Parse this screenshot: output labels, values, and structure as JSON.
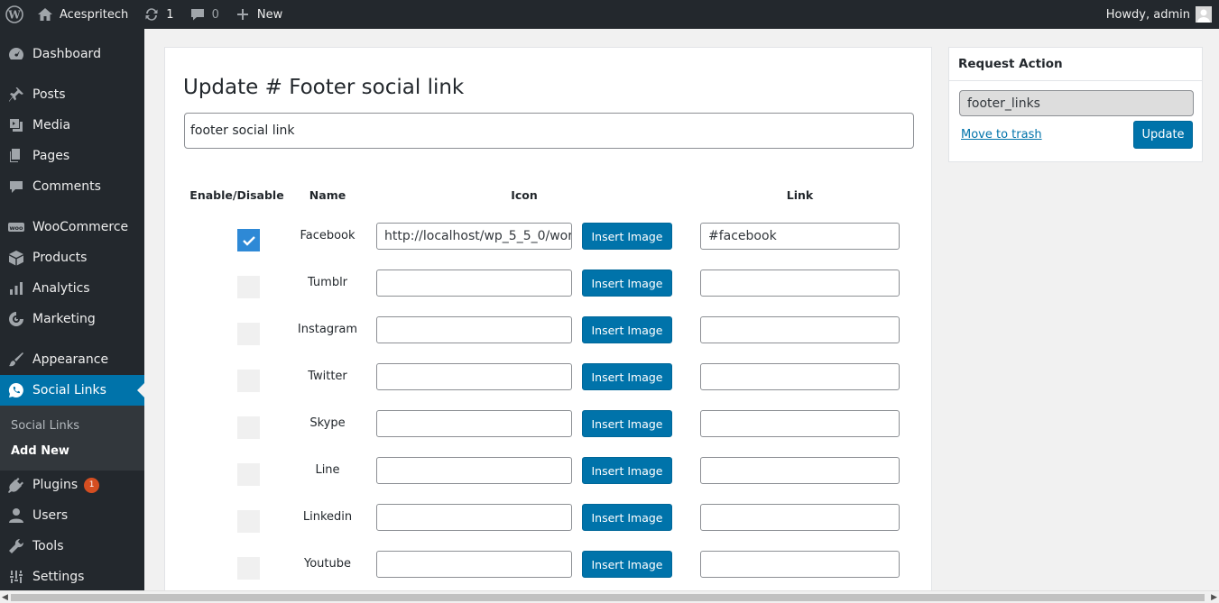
{
  "adminbar": {
    "site_name": "Acespritech",
    "updates_count": "1",
    "comments_count": "0",
    "new_label": "New",
    "greeting": "Howdy, admin"
  },
  "sidebar": {
    "items": [
      {
        "label": "Dashboard",
        "icon": "dashboard-icon"
      },
      {
        "label": "Posts",
        "icon": "pin-icon"
      },
      {
        "label": "Media",
        "icon": "media-icon"
      },
      {
        "label": "Pages",
        "icon": "pages-icon"
      },
      {
        "label": "Comments",
        "icon": "comment-icon"
      },
      {
        "label": "WooCommerce",
        "icon": "woo-icon"
      },
      {
        "label": "Products",
        "icon": "box-icon"
      },
      {
        "label": "Analytics",
        "icon": "bar-chart-icon"
      },
      {
        "label": "Marketing",
        "icon": "megaphone-icon"
      },
      {
        "label": "Appearance",
        "icon": "brush-icon"
      },
      {
        "label": "Social Links",
        "icon": "whatsapp-icon"
      },
      {
        "label": "Plugins",
        "icon": "plug-icon",
        "badge": "1"
      },
      {
        "label": "Users",
        "icon": "user-icon"
      },
      {
        "label": "Tools",
        "icon": "wrench-icon"
      },
      {
        "label": "Settings",
        "icon": "settings-icon"
      }
    ],
    "submenu": [
      "Social Links",
      "Add New"
    ]
  },
  "main": {
    "title": "Update # Footer social link",
    "title_value": "footer social link",
    "columns": {
      "enable": "Enable/Disable",
      "name": "Name",
      "icon": "Icon",
      "link": "Link"
    },
    "insert_label": "Insert Image",
    "rows": [
      {
        "name": "Facebook",
        "enabled": true,
        "icon_url": "http://localhost/wp_5_5_0/wor",
        "link": "#facebook"
      },
      {
        "name": "Tumblr",
        "enabled": false,
        "icon_url": "",
        "link": ""
      },
      {
        "name": "Instagram",
        "enabled": false,
        "icon_url": "",
        "link": ""
      },
      {
        "name": "Twitter",
        "enabled": false,
        "icon_url": "",
        "link": ""
      },
      {
        "name": "Skype",
        "enabled": false,
        "icon_url": "",
        "link": ""
      },
      {
        "name": "Line",
        "enabled": false,
        "icon_url": "",
        "link": ""
      },
      {
        "name": "Linkedin",
        "enabled": false,
        "icon_url": "",
        "link": ""
      },
      {
        "name": "Youtube",
        "enabled": false,
        "icon_url": "",
        "link": ""
      }
    ]
  },
  "request_action": {
    "title": "Request Action",
    "slug": "footer_links",
    "trash_label": "Move to trash",
    "update_label": "Update"
  },
  "colors": {
    "admin_bg": "#23282d",
    "accent": "#0073aa",
    "badge": "#d54e21",
    "checkbox_on": "#2e89d6"
  }
}
